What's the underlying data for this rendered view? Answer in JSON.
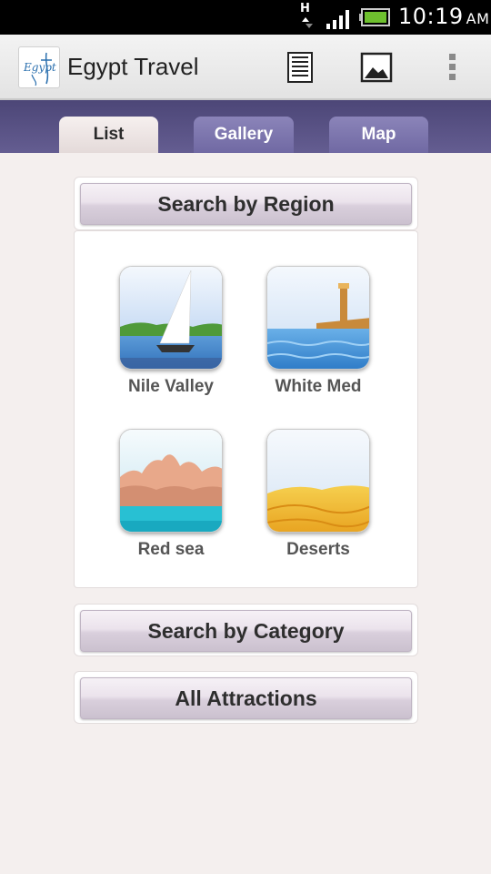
{
  "status_bar": {
    "network_type": "H",
    "time": "10:19",
    "ampm": "AM",
    "icons": [
      "data-transfer-icon",
      "signal-icon",
      "battery-icon"
    ]
  },
  "action_bar": {
    "logo_text": "Egypt",
    "title": "Egypt Travel",
    "icons": [
      "list-view-icon",
      "image-view-icon",
      "overflow-menu-icon"
    ]
  },
  "tabs": [
    {
      "label": "List",
      "selected": true
    },
    {
      "label": "Gallery",
      "selected": false
    },
    {
      "label": "Map",
      "selected": false
    }
  ],
  "search_by_region": {
    "label": "Search by Region",
    "regions": [
      {
        "label": "Nile Valley",
        "icon": "nile-valley-icon"
      },
      {
        "label": "White Med",
        "icon": "white-med-icon"
      },
      {
        "label": "Red sea",
        "icon": "red-sea-icon"
      },
      {
        "label": "Deserts",
        "icon": "deserts-icon"
      }
    ]
  },
  "search_by_category": {
    "label": "Search by Category"
  },
  "all_attractions": {
    "label": "All Attractions"
  },
  "colors": {
    "tab_bar": "#574f85",
    "tab_selected": "#efe7e6",
    "tab_unselected": "#7c75ad",
    "background": "#f4efee"
  }
}
